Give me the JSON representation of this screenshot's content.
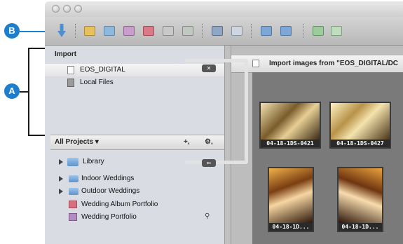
{
  "callouts": {
    "a": "A",
    "b": "B"
  },
  "sidebar": {
    "import_header": "Import",
    "import_items": [
      {
        "label": "EOS_DIGITAL",
        "icon": "drive-icon",
        "selected": true
      },
      {
        "label": "Local Files",
        "icon": "hard-disk-icon",
        "selected": false
      }
    ],
    "projects_menu": "All Projects ▾",
    "add_label": "+,",
    "action_label": "⚙,",
    "library_items": [
      {
        "label": "Library",
        "icon": "library-icon"
      },
      {
        "label": "Indoor Weddings",
        "icon": "folder-icon"
      },
      {
        "label": "Outdoor Weddings",
        "icon": "folder-icon"
      },
      {
        "label": "Wedding Album Portfolio",
        "icon": "album-icon"
      },
      {
        "label": "Wedding Portfolio",
        "icon": "smart-album-icon"
      }
    ]
  },
  "import_panel": {
    "title": "Import images from \"EOS_DIGITAL/DC",
    "thumbnails": [
      {
        "caption": "04-18-1DS-0421"
      },
      {
        "caption": "04-18-1DS-0427"
      },
      {
        "caption": "04-18-1D..."
      },
      {
        "caption": "04-18-1D..."
      }
    ]
  },
  "colors": {
    "accent": "#1f7ecb",
    "selection": "#f0f0f0"
  }
}
